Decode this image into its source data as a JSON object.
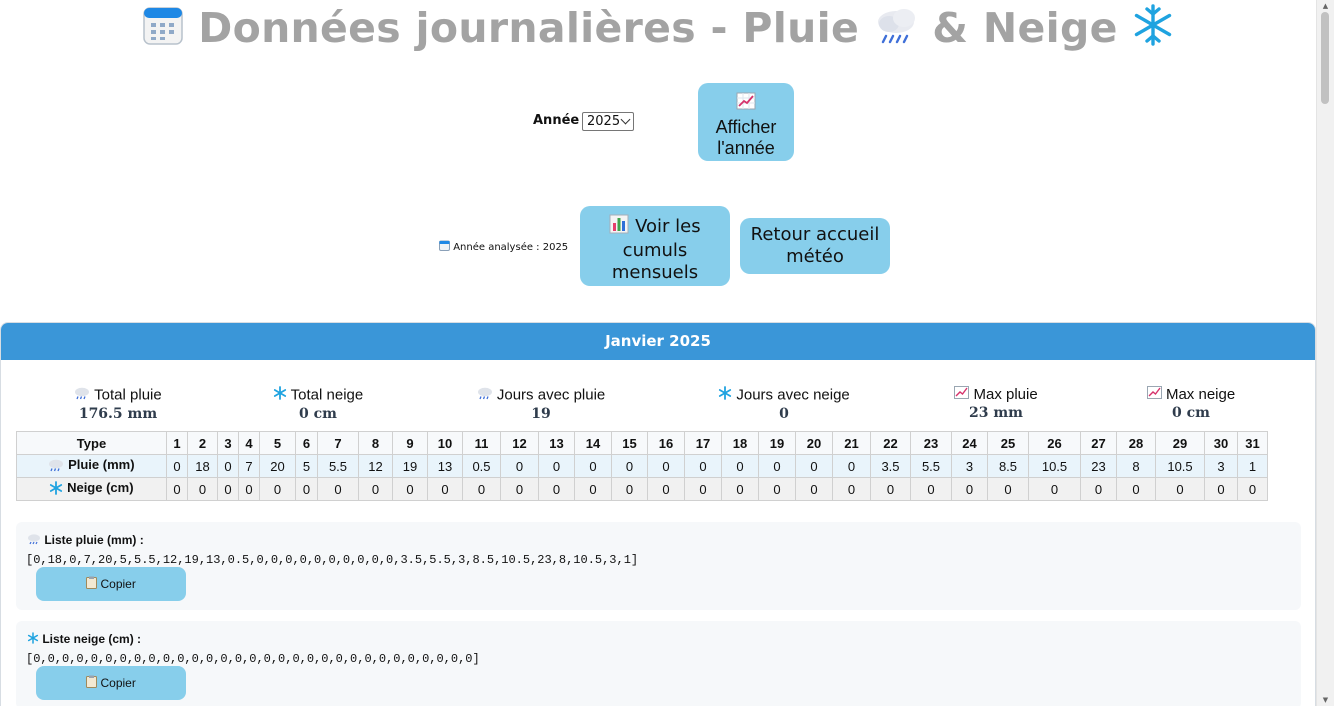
{
  "title": {
    "text_a": "Données journalières - Pluie",
    "text_b": "& Neige"
  },
  "year_selector": {
    "label": "Année :",
    "value": "2025"
  },
  "buttons": {
    "show_year": "Afficher l'année",
    "monthly_totals": "Voir les cumuls mensuels",
    "home": "Retour accueil météo"
  },
  "analysed_year": "Année analysée : 2025",
  "month": {
    "header": "Janvier 2025",
    "stats": [
      {
        "label": "Total pluie",
        "value": "176.5 mm",
        "icon": "rain-cloud-icon"
      },
      {
        "label": "Total neige",
        "value": "0 cm",
        "icon": "snowflake-icon"
      },
      {
        "label": "Jours avec pluie",
        "value": "19",
        "icon": "rain-cloud-icon"
      },
      {
        "label": "Jours avec neige",
        "value": "0",
        "icon": "snowflake-icon"
      },
      {
        "label": "Max pluie",
        "value": "23 mm",
        "icon": "chart-up-icon"
      },
      {
        "label": "Max neige",
        "value": "0 cm",
        "icon": "chart-up-icon"
      }
    ],
    "table": {
      "type_header": "Type",
      "days": [
        "1",
        "2",
        "3",
        "4",
        "5",
        "6",
        "7",
        "8",
        "9",
        "10",
        "11",
        "12",
        "13",
        "14",
        "15",
        "16",
        "17",
        "18",
        "19",
        "20",
        "21",
        "22",
        "23",
        "24",
        "25",
        "26",
        "27",
        "28",
        "29",
        "30",
        "31"
      ],
      "rain_label": "Pluie (mm)",
      "snow_label": "Neige (cm)",
      "rain": [
        "0",
        "18",
        "0",
        "7",
        "20",
        "5",
        "5.5",
        "12",
        "19",
        "13",
        "0.5",
        "0",
        "0",
        "0",
        "0",
        "0",
        "0",
        "0",
        "0",
        "0",
        "0",
        "3.5",
        "5.5",
        "3",
        "8.5",
        "10.5",
        "23",
        "8",
        "10.5",
        "3",
        "1"
      ],
      "snow": [
        "0",
        "0",
        "0",
        "0",
        "0",
        "0",
        "0",
        "0",
        "0",
        "0",
        "0",
        "0",
        "0",
        "0",
        "0",
        "0",
        "0",
        "0",
        "0",
        "0",
        "0",
        "0",
        "0",
        "0",
        "0",
        "0",
        "0",
        "0",
        "0",
        "0",
        "0"
      ]
    },
    "rain_list": {
      "title": "Liste pluie (mm) :",
      "value": "[0,18,0,7,20,5,5.5,12,19,13,0.5,0,0,0,0,0,0,0,0,0,0,3.5,5.5,3,8.5,10.5,23,8,10.5,3,1]",
      "copy": "Copier"
    },
    "snow_list": {
      "title": "Liste neige (cm) :",
      "value": "[0,0,0,0,0,0,0,0,0,0,0,0,0,0,0,0,0,0,0,0,0,0,0,0,0,0,0,0,0,0,0]",
      "copy": "Copier"
    }
  },
  "colors": {
    "title": "#a3a3a3",
    "button": "#87ceeb",
    "month_header": "#3a96d8",
    "stat_value": "#2f3c4c"
  }
}
